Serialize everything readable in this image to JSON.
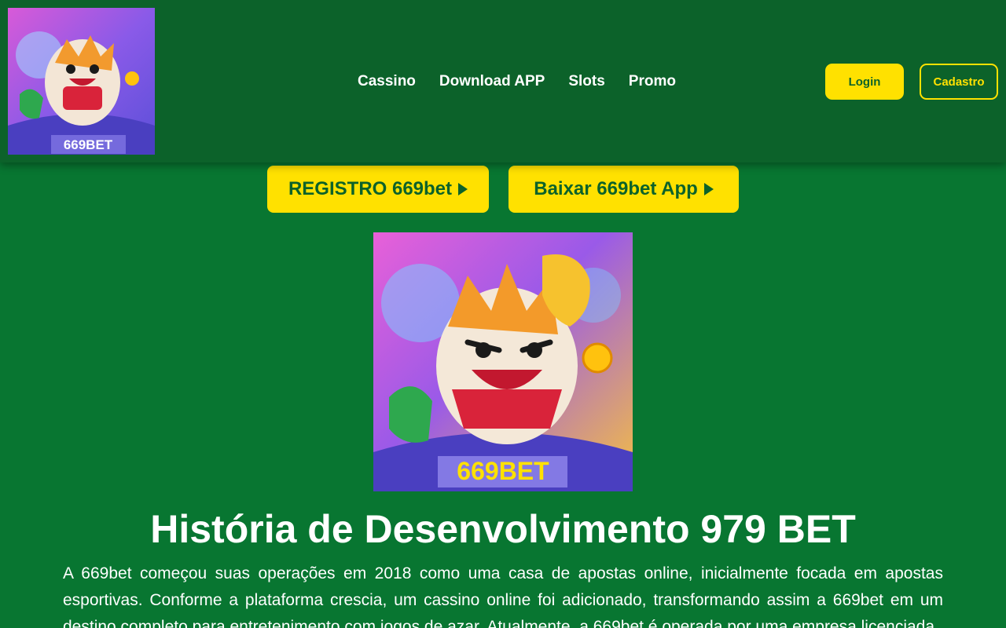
{
  "header": {
    "logo_text": "669BET",
    "nav": [
      "Cassino",
      "Download APP",
      "Slots",
      "Promo"
    ],
    "login_label": "Login",
    "cadastro_label": "Cadastro"
  },
  "cta": {
    "register_label": "REGISTRO 669bet",
    "download_label": "Baixar 669bet App"
  },
  "hero": {
    "badge_text": "669BET"
  },
  "article": {
    "title": "História de Desenvolvimento 979 BET",
    "paragraph": "A 669bet começou suas operações em 2018 como uma casa de apostas online, inicialmente focada em apostas esportivas. Conforme a plataforma crescia, um cassino online foi adicionado, transformando assim a 669bet em um destino completo para entretenimento com jogos de azar. Atualmente, a 669bet é operada por uma empresa licenciada"
  },
  "colors": {
    "background": "#087631",
    "header": "#0c622a",
    "accent": "#ffe100"
  }
}
